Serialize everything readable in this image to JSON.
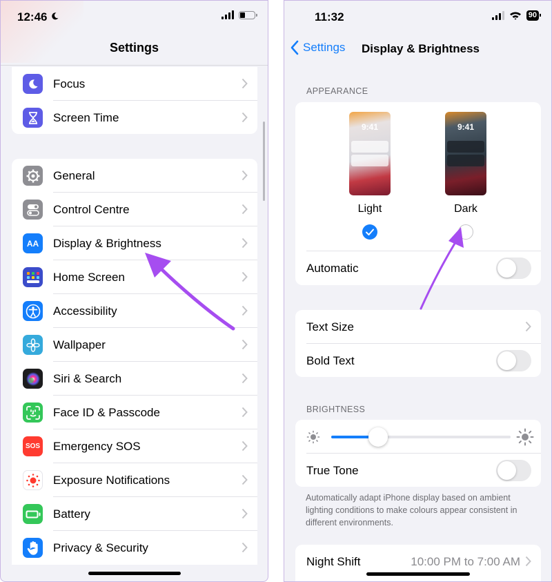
{
  "left": {
    "status": {
      "time": "12:46"
    },
    "nav_title": "Settings",
    "groups": [
      {
        "items": [
          {
            "label": "Focus",
            "icon": "moon-icon",
            "color": "#5e5ce6"
          },
          {
            "label": "Screen Time",
            "icon": "hourglass-icon",
            "color": "#5e5ce6"
          }
        ]
      },
      {
        "items": [
          {
            "label": "General",
            "icon": "gear-icon",
            "color": "#8e8e93"
          },
          {
            "label": "Control Centre",
            "icon": "toggles-icon",
            "color": "#8e8e93"
          },
          {
            "label": "Display & Brightness",
            "icon": "text-size-icon",
            "color": "#147efb",
            "icon_text": "AA"
          },
          {
            "label": "Home Screen",
            "icon": "app-grid-icon",
            "color": "#3b4cca"
          },
          {
            "label": "Accessibility",
            "icon": "accessibility-icon",
            "color": "#147efb"
          },
          {
            "label": "Wallpaper",
            "icon": "flower-icon",
            "color": "#35aadc"
          },
          {
            "label": "Siri & Search",
            "icon": "siri-icon",
            "color": "#1c1c1e"
          },
          {
            "label": "Face ID & Passcode",
            "icon": "face-id-icon",
            "color": "#34c759"
          },
          {
            "label": "Emergency SOS",
            "icon": "sos-icon",
            "color": "#ff3b30",
            "icon_text": "SOS"
          },
          {
            "label": "Exposure Notifications",
            "icon": "exposure-icon",
            "color": "#ffffff"
          },
          {
            "label": "Battery",
            "icon": "battery-icon",
            "color": "#34c759"
          },
          {
            "label": "Privacy & Security",
            "icon": "hand-icon",
            "color": "#147efb"
          }
        ]
      }
    ]
  },
  "right": {
    "status": {
      "time": "11:32",
      "battery": "90"
    },
    "back_label": "Settings",
    "nav_title": "Display & Brightness",
    "appearance": {
      "header": "APPEARANCE",
      "light_label": "Light",
      "dark_label": "Dark",
      "thumb_time": "9:41",
      "selected": "Light",
      "automatic_label": "Automatic",
      "automatic_on": false
    },
    "text": {
      "text_size_label": "Text Size",
      "bold_text_label": "Bold Text",
      "bold_text_on": false
    },
    "brightness": {
      "header": "BRIGHTNESS",
      "level": 0.26,
      "true_tone_label": "True Tone",
      "true_tone_on": false,
      "footer": "Automatically adapt iPhone display based on ambient lighting conditions to make colours appear consistent in different environments."
    },
    "night_shift": {
      "label": "Night Shift",
      "value": "10:00 PM to 7:00 AM"
    }
  },
  "colors": {
    "accent": "#147efb",
    "arrow": "#a64df0"
  }
}
